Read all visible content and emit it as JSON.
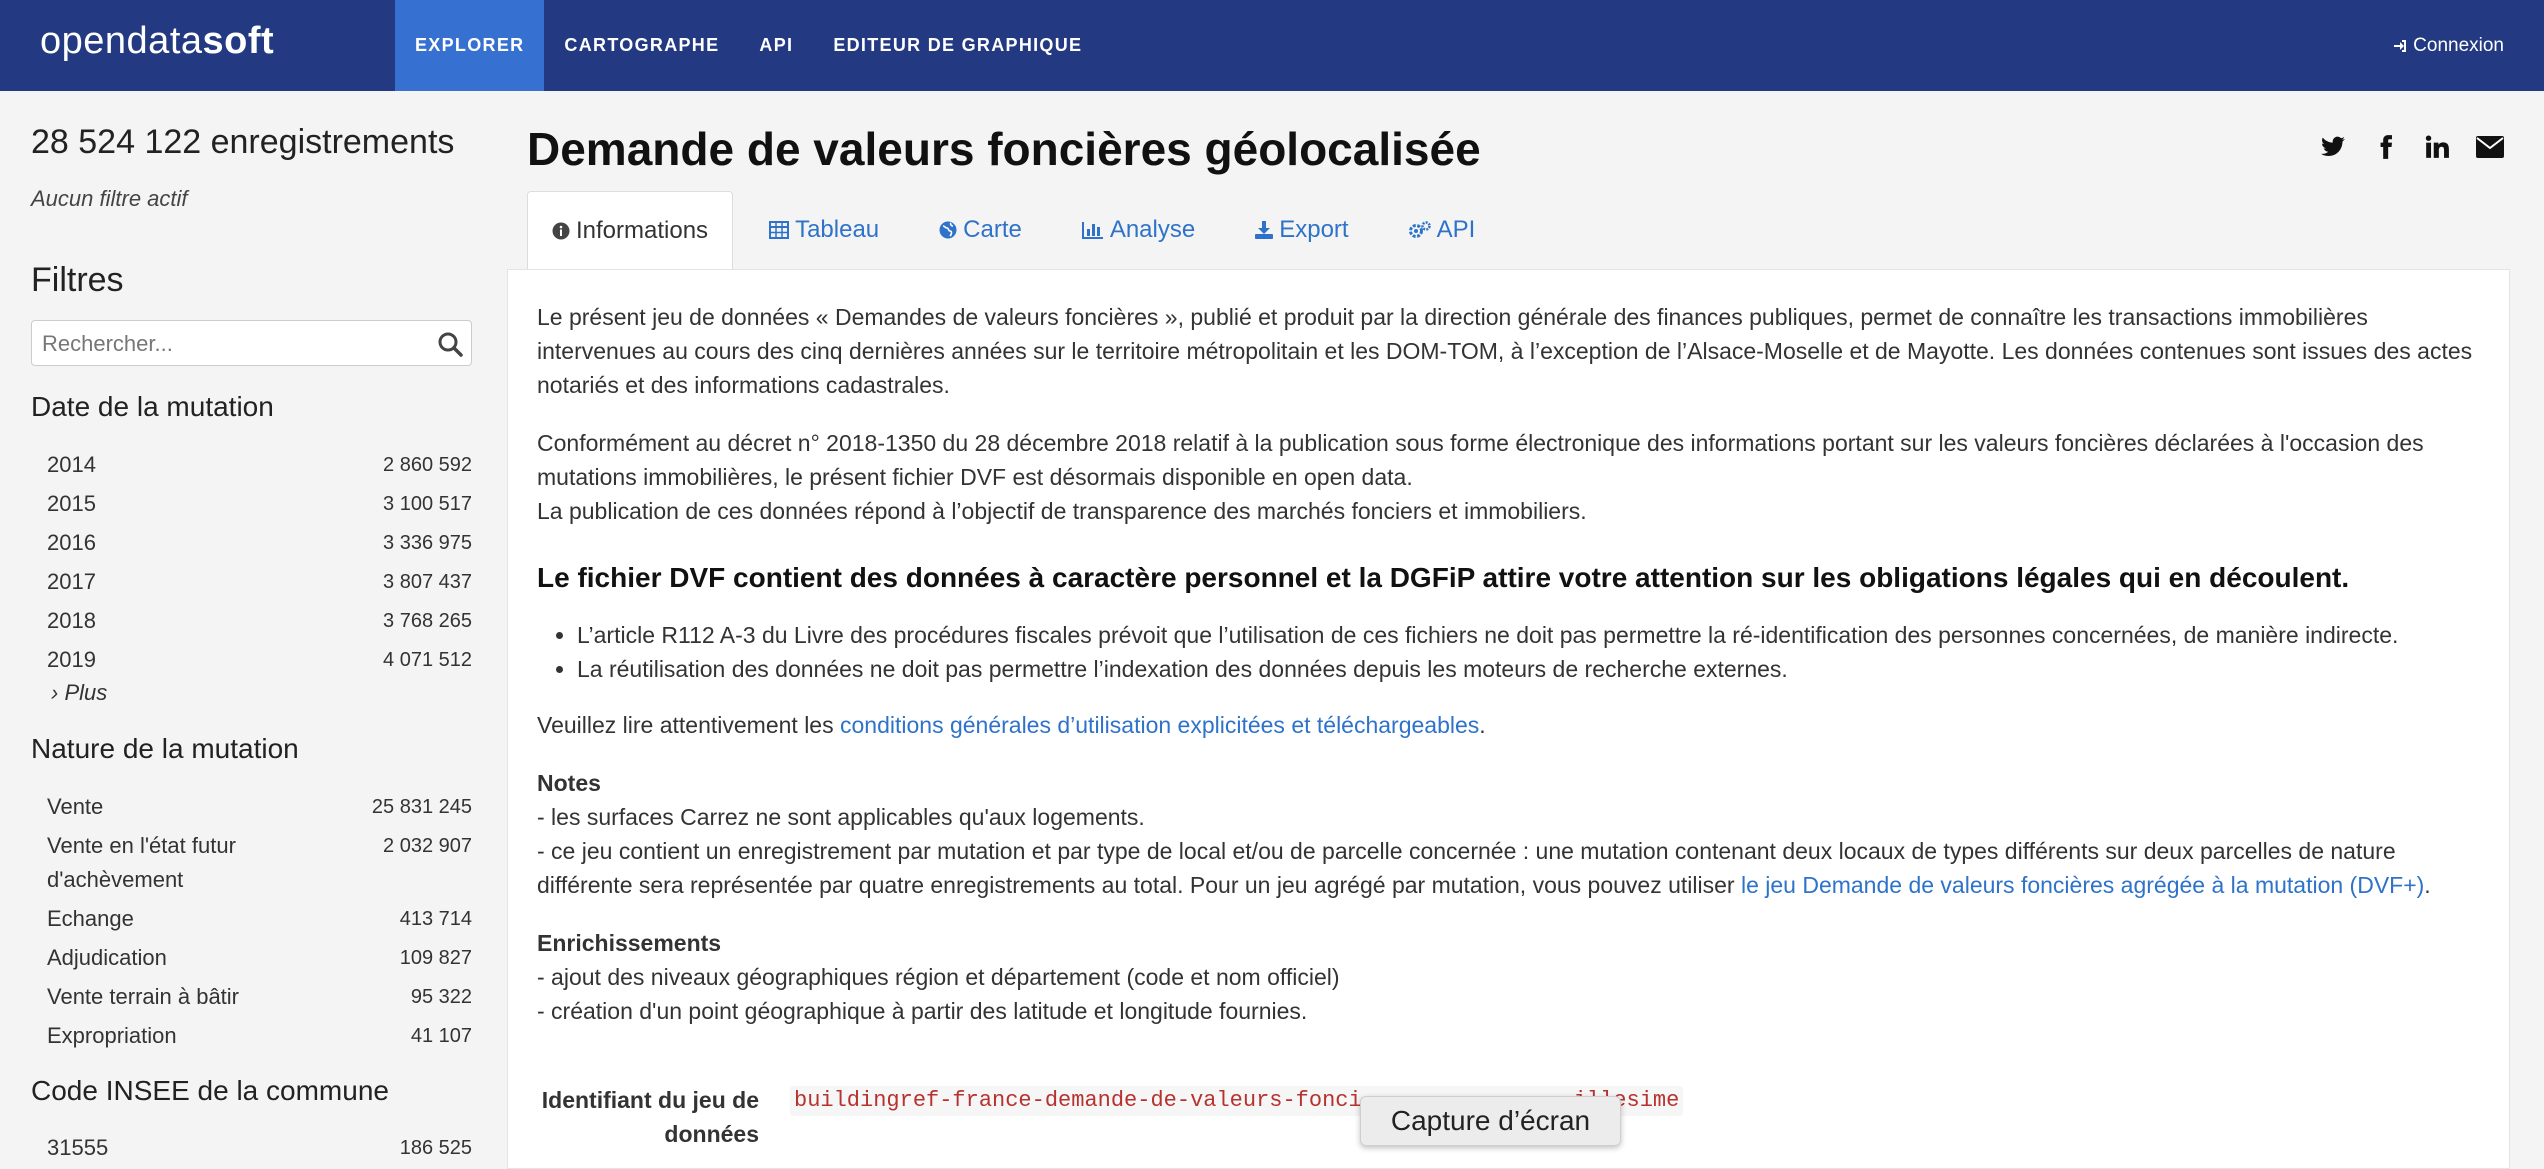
{
  "header": {
    "logo_text": "opendatasoft",
    "nav": [
      {
        "label": "EXPLORER",
        "active": true
      },
      {
        "label": "CARTOGRAPHE"
      },
      {
        "label": "API"
      },
      {
        "label": "EDITEUR DE GRAPHIQUE"
      }
    ],
    "login_label": "Connexion",
    "login_icon": "sign-in-icon"
  },
  "sidebar": {
    "record_count": "28 524 122 enregistrements",
    "no_filter": "Aucun filtre actif",
    "filters_title": "Filtres",
    "search_placeholder": "Rechercher...",
    "facets": [
      {
        "title": "Date de la mutation",
        "items": [
          {
            "label": "2014",
            "count": "2 860 592"
          },
          {
            "label": "2015",
            "count": "3 100 517"
          },
          {
            "label": "2016",
            "count": "3 336 975"
          },
          {
            "label": "2017",
            "count": "3 807 437"
          },
          {
            "label": "2018",
            "count": "3 768 265"
          },
          {
            "label": "2019",
            "count": "4 071 512"
          }
        ],
        "more_label": "Plus"
      },
      {
        "title": "Nature de la mutation",
        "items": [
          {
            "label": "Vente",
            "count": "25 831 245"
          },
          {
            "label": "Vente en l'état futur d'achèvement",
            "count": "2 032 907"
          },
          {
            "label": "Echange",
            "count": "413 714"
          },
          {
            "label": "Adjudication",
            "count": "109 827"
          },
          {
            "label": "Vente terrain à bâtir",
            "count": "95 322"
          },
          {
            "label": "Expropriation",
            "count": "41 107"
          }
        ]
      },
      {
        "title": "Code INSEE de la commune",
        "items": [
          {
            "label": "31555",
            "count": "186 525"
          }
        ]
      }
    ]
  },
  "main": {
    "title": "Demande de valeurs foncières géolocalisée",
    "share_icons": [
      "twitter-icon",
      "facebook-icon",
      "linkedin-icon",
      "envelope-icon"
    ],
    "tabs": [
      {
        "label": "Informations",
        "icon": "info-circle-icon",
        "active": true
      },
      {
        "label": "Tableau",
        "icon": "table-icon"
      },
      {
        "label": "Carte",
        "icon": "globe-icon"
      },
      {
        "label": "Analyse",
        "icon": "bar-chart-icon"
      },
      {
        "label": "Export",
        "icon": "download-icon"
      },
      {
        "label": "API",
        "icon": "cogs-icon"
      }
    ],
    "description": {
      "p1": "Le présent jeu de données « Demandes de valeurs foncières », publié et produit par la direction générale des finances publiques, permet de connaître les transactions immobilières intervenues au cours des cinq dernières années sur le territoire métropolitain et les DOM-TOM, à l’exception de l’Alsace-Moselle et de Mayotte. Les données contenues sont issues des actes notariés et des informations cadastrales.",
      "p2_line1": "Conformément au décret n° 2018-1350 du 28 décembre 2018 relatif à la publication sous forme électronique des informations portant sur les valeurs foncières déclarées à l'occasion des mutations immobilières, le présent fichier DVF est désormais disponible en open data.",
      "p2_line2": "La publication de ces données répond à l’objectif de transparence des marchés fonciers et immobiliers.",
      "warning_title": "Le fichier DVF contient des données à caractère personnel et la DGFiP attire votre attention sur les obligations légales qui en découlent.",
      "warning_items": [
        "L’article R112 A-3 du Livre des procédures fiscales prévoit que l’utilisation de ces fichiers ne doit pas permettre la ré-identification des personnes concernées, de manière indirecte.",
        "La réutilisation des données ne doit pas permettre l’indexation des données depuis les moteurs de recherche externes."
      ],
      "read_prefix": "Veuillez lire attentivement les ",
      "read_link": "conditions générales d’utilisation explicitées et téléchargeables",
      "read_suffix": ".",
      "notes_title": "Notes",
      "notes_line1": "- les surfaces Carrez ne sont applicables qu'aux logements.",
      "notes_line2": "- ce jeu contient un enregistrement par mutation et par type de local et/ou de parcelle concernée : une mutation contenant deux locaux de types différents sur deux parcelles de nature différente sera représentée par quatre enregistrements au total. Pour un jeu agrégé par mutation, vous pouvez utiliser ",
      "notes_link": "le jeu Demande de valeurs foncières agrégée à la mutation (DVF+)",
      "notes_suffix": ".",
      "enrich_title": "Enrichissements",
      "enrich_line1": "- ajout des niveaux géographiques région et département (code et nom officiel)",
      "enrich_line2": "- création d'un point géographique à partir des latitude et longitude fournies."
    },
    "meta": {
      "id_label": "Identifiant du jeu de données",
      "id_value": "buildingref-france-demande-de-valeurs-fonci",
      "id_value_tail": "illesime"
    }
  },
  "overlay": {
    "tooltip": "Capture d’écran"
  },
  "colors": {
    "header_bg": "#233a82",
    "nav_active_bg": "#3670d1",
    "link": "#2e73c9",
    "code": "#b7322f"
  }
}
